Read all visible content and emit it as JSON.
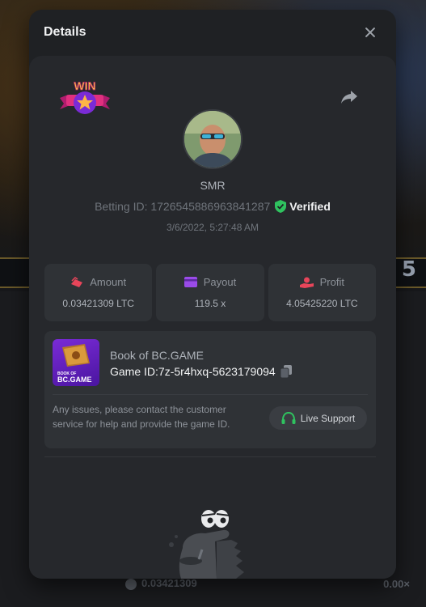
{
  "modal": {
    "title": "Details"
  },
  "player": {
    "username": "SMR",
    "betting_id_label": "Betting ID: 1726545886963841287",
    "verified_label": "Verified",
    "timestamp": "3/6/2022, 5:27:48 AM"
  },
  "badge": {
    "text": "WIN"
  },
  "stats": [
    {
      "label": "Amount",
      "value": "0.03421309 LTC",
      "icon": "money-wing-icon",
      "color": "#e8455a"
    },
    {
      "label": "Payout",
      "value": "119.5 x",
      "icon": "wallet-card-icon",
      "color": "#9a4be8"
    },
    {
      "label": "Profit",
      "value": "4.05425220 LTC",
      "icon": "profit-hand-icon",
      "color": "#e8455a"
    }
  ],
  "game": {
    "name": "Book of BC.GAME",
    "game_id_label": "Game ID:7z-5r4hxq-5623179094",
    "thumb_text_top": "BOOK OF",
    "thumb_text_bottom": "BC.GAME",
    "issue_text": "Any issues, please contact the customer service for help and provide the game ID.",
    "support_label": "Live Support"
  },
  "background": {
    "digits": "2 5",
    "footer_amount": "0.03421309",
    "footer_right": "0.00×"
  },
  "colors": {
    "verified": "#2fc25f",
    "support_icon": "#2fc25f",
    "modal_bg": "#1f2124",
    "card_bg": "#2f3236"
  }
}
